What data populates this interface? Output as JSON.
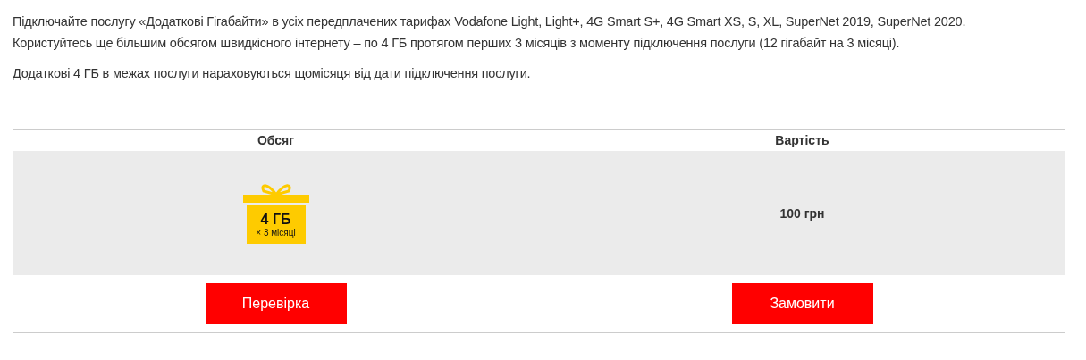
{
  "description": [
    "Підключайте послугу «Додаткові Гігабайти» в усіх передплачених тарифах Vodafone Light, Light+, 4G Smart S+, 4G Smart XS, S, XL, SuperNet 2019, SuperNet 2020.",
    "Користуйтесь ще більшим обсягом швидкісного інтернету – по 4 ГБ протягом перших 3 місяців з моменту підключення послуги (12 гігабайт на 3 місяці).",
    "Додаткові 4 ГБ в межах послуги нараховуються щомісяця від дати підключення послуги."
  ],
  "table": {
    "columns": [
      "Обсяг",
      "Вартість"
    ],
    "row": {
      "gift": {
        "amount": "4 ГБ",
        "period": "× 3 місяці"
      },
      "price": "100 грн"
    },
    "buttons": [
      "Перевірка",
      "Замовити"
    ]
  }
}
